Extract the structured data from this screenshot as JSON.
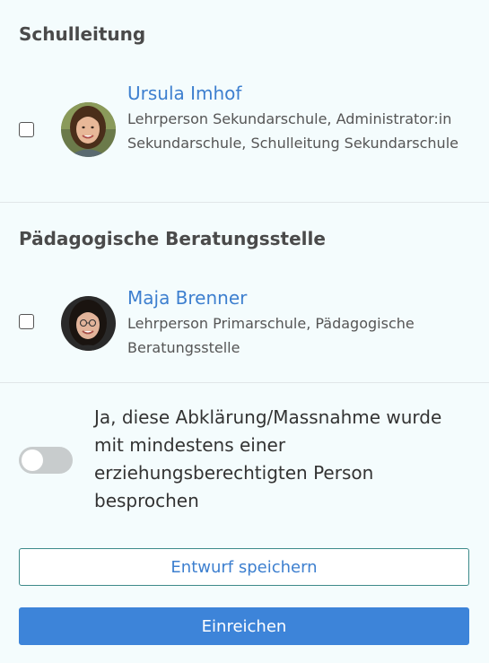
{
  "sections": [
    {
      "title": "Schulleitung",
      "people": [
        {
          "name": "Ursula Imhof",
          "roles": "Lehrperson Sekundarschule, Administrator:in Sekundarschule, Schulleitung Sekundarschule",
          "checked": false
        }
      ]
    },
    {
      "title": "Pädagogische Beratungsstelle",
      "people": [
        {
          "name": "Maja Brenner",
          "roles": "Lehrperson Primarschule, Pädagogische Beratungsstelle",
          "checked": false
        }
      ]
    }
  ],
  "consent": {
    "text": "Ja, diese Abklärung/Massnahme wurde mit mindestens einer erziehungsberechtigten Person besprochen",
    "enabled": false
  },
  "actions": {
    "save_draft_label": "Entwurf speichern",
    "submit_label": "Einreichen"
  },
  "colors": {
    "background": "#f4fcfd",
    "link": "#3d7fcf",
    "primary": "#3d84d9",
    "toggle_off": "#c8cccd"
  },
  "icons": {
    "checkbox": "checkbox-unchecked-icon",
    "avatar": "user-avatar"
  }
}
